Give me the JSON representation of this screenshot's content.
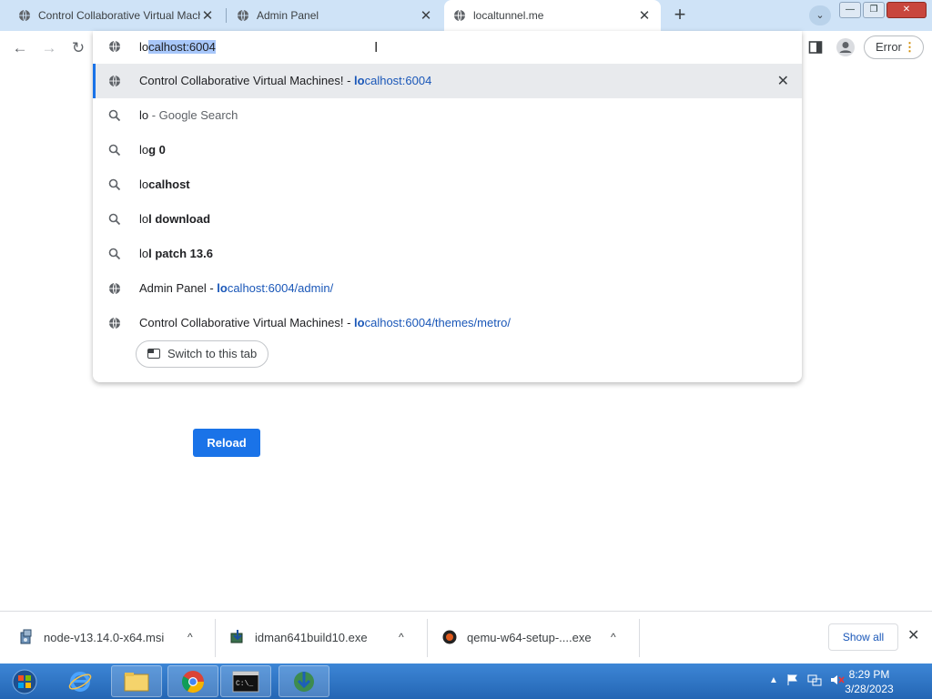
{
  "tabs": [
    {
      "title": "Control Collaborative Virtual Machines!",
      "close": "✕"
    },
    {
      "title": "Admin Panel",
      "close": "✕"
    },
    {
      "title": "localtunnel.me",
      "close": "✕"
    }
  ],
  "new_tab": "+",
  "tab_search": "⌄",
  "window_buttons": {
    "minimize": "—",
    "maximize": "❐",
    "close": "✕"
  },
  "nav": {
    "back": "←",
    "forward": "→",
    "reload": "↻"
  },
  "omnibox": {
    "typed": "lo",
    "autocomplete_selected": "calhost:6004"
  },
  "suggestions": [
    {
      "type": "history",
      "prefix": "Control Collaborative Virtual Machines! - ",
      "url_bold": "lo",
      "url_rest": "calhost:6004",
      "remove": "✕"
    },
    {
      "type": "search",
      "typed": "lo",
      "rest": "",
      "suffix": " - Google Search"
    },
    {
      "type": "search",
      "typed": "lo",
      "rest": "g 0"
    },
    {
      "type": "search",
      "typed": "lo",
      "rest": "calhost"
    },
    {
      "type": "search",
      "typed": "lo",
      "rest": "l download"
    },
    {
      "type": "search",
      "typed": "lo",
      "rest": "l patch 13.6"
    },
    {
      "type": "history",
      "prefix": "Admin Panel - ",
      "url_bold": "lo",
      "url_rest": "calhost:6004/admin/"
    },
    {
      "type": "history",
      "prefix": "Control Collaborative Virtual Machines! - ",
      "url_bold": "lo",
      "url_rest": "calhost:6004/themes/metro/"
    }
  ],
  "switch_tab_label": "Switch to this tab",
  "profile": {
    "error_label": "Error",
    "menu": "⋮"
  },
  "page": {
    "reload_label": "Reload"
  },
  "downloads": [
    {
      "name": "node-v13.14.0-x64.msi",
      "caret": "^"
    },
    {
      "name": "idman641build10.exe",
      "caret": "^"
    },
    {
      "name": "qemu-w64-setup-....exe",
      "caret": "^"
    }
  ],
  "downloads_show_all": "Show all",
  "downloads_close": "✕",
  "taskbar": {
    "time": "8:29 PM",
    "date": "3/28/2023"
  },
  "colors": {
    "accent": "#1a73e8",
    "titlebar": "#cfe3f7",
    "taskbar": "#2466b4"
  }
}
